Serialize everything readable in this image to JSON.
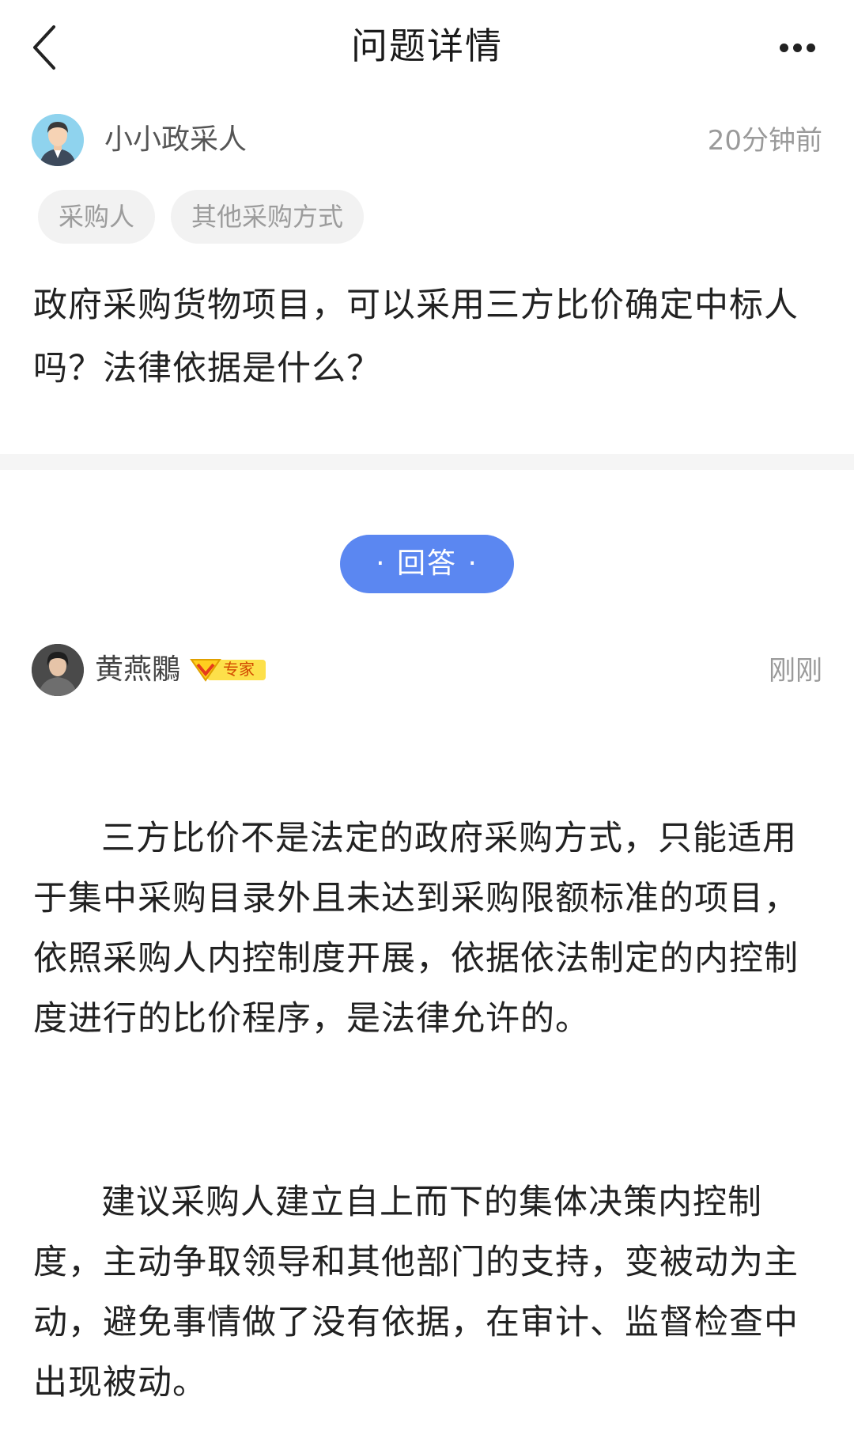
{
  "header": {
    "title": "问题详情",
    "back_icon": "chevron-left-icon",
    "more_icon": "more-dots-icon"
  },
  "question": {
    "author": "小小政采人",
    "time": "20分钟前",
    "tags": [
      "采购人",
      "其他采购方式"
    ],
    "text": "政府采购货物项目，可以采用三方比价确定中标人吗？法律依据是什么？"
  },
  "answer_divider": {
    "label": "· 回答 ·",
    "color": "#5b87f1"
  },
  "answer": {
    "author": "黄燕鷴",
    "badge": "专家",
    "time": "刚刚",
    "paragraphs": [
      "三方比价不是法定的政府采购方式，只能适用于集中采购目录外且未达到采购限额标准的项目，依照采购人内控制度开展，依据依法制定的内控制度进行的比价程序，是法律允许的。",
      "建议采购人建立自上而下的集体决策内控制度，主动争取领导和其他部门的支持，变被动为主动，避免事情做了没有依据，在审计、监督检查中出现被动。"
    ]
  }
}
